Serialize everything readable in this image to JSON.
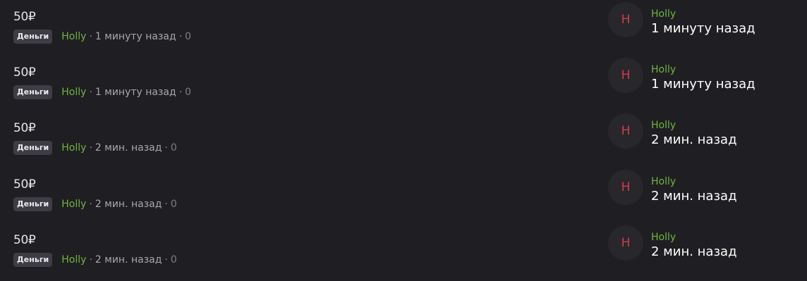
{
  "items": [
    {
      "title": "50₽",
      "tag": "Деньги",
      "author": "Holly",
      "time": "1 минуту назад",
      "count": "0",
      "avatar_letter": "H",
      "side_author": "Holly",
      "side_time": "1 минуту назад"
    },
    {
      "title": "50₽",
      "tag": "Деньги",
      "author": "Holly",
      "time": "1 минуту назад",
      "count": "0",
      "avatar_letter": "H",
      "side_author": "Holly",
      "side_time": "1 минуту назад"
    },
    {
      "title": "50₽",
      "tag": "Деньги",
      "author": "Holly",
      "time": "2 мин. назад",
      "count": "0",
      "avatar_letter": "H",
      "side_author": "Holly",
      "side_time": "2 мин. назад"
    },
    {
      "title": "50₽",
      "tag": "Деньги",
      "author": "Holly",
      "time": "2 мин. назад",
      "count": "0",
      "avatar_letter": "H",
      "side_author": "Holly",
      "side_time": "2 мин. назад"
    },
    {
      "title": "50₽",
      "tag": "Деньги",
      "author": "Holly",
      "time": "2 мин. назад",
      "count": "0",
      "avatar_letter": "H",
      "side_author": "Holly",
      "side_time": "2 мин. назад"
    }
  ],
  "separator": "·",
  "colors": {
    "background": "#1f1f23",
    "author": "#6fb43f",
    "avatar_letter": "#d33b4f",
    "tag_background": "#3d3d44"
  }
}
